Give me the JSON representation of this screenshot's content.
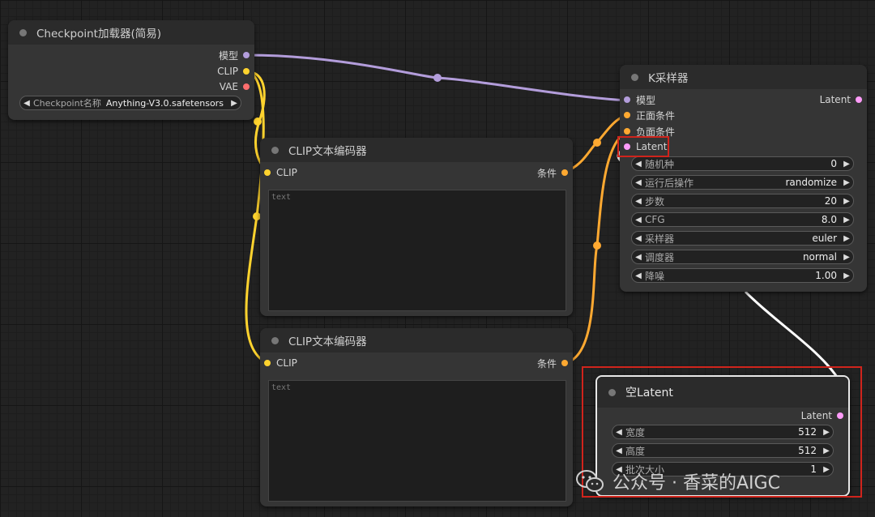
{
  "colors": {
    "model": "#b39ddb",
    "clip": "#ffd32e",
    "vae": "#ff6e6e",
    "conditioning": "#ffa931",
    "latent": "#ff9cf9",
    "highlight": "#d0241c"
  },
  "checkpoint_node": {
    "title": "Checkpoint加载器(简易)",
    "outputs": [
      "模型",
      "CLIP",
      "VAE"
    ],
    "widget": {
      "name": "Checkpoint名称",
      "value": "Anything-V3.0.safetensors"
    }
  },
  "clip_node_1": {
    "title": "CLIP文本编码器",
    "input": "CLIP",
    "output": "条件",
    "text_placeholder": "text"
  },
  "clip_node_2": {
    "title": "CLIP文本编码器",
    "input": "CLIP",
    "output": "条件",
    "text_placeholder": "text"
  },
  "ksampler_node": {
    "title": "K采样器",
    "inputs": [
      "模型",
      "正面条件",
      "负面条件",
      "Latent"
    ],
    "output": "Latent",
    "widgets": [
      {
        "name": "随机种",
        "value": "0"
      },
      {
        "name": "运行后操作",
        "value": "randomize"
      },
      {
        "name": "步数",
        "value": "20"
      },
      {
        "name": "CFG",
        "value": "8.0"
      },
      {
        "name": "采样器",
        "value": "euler"
      },
      {
        "name": "调度器",
        "value": "normal"
      },
      {
        "name": "降噪",
        "value": "1.00"
      }
    ]
  },
  "empty_latent_node": {
    "title": "空Latent",
    "output": "Latent",
    "widgets": [
      {
        "name": "宽度",
        "value": "512"
      },
      {
        "name": "高度",
        "value": "512"
      },
      {
        "name": "批次大小",
        "value": "1"
      }
    ]
  },
  "watermark": "公众号 · 香菜的AIGC",
  "icons": {
    "arrow_left": "◀",
    "arrow_right": "▶"
  }
}
